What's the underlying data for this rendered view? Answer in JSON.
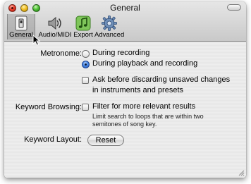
{
  "window": {
    "title": "General"
  },
  "toolbar": {
    "tabs": [
      {
        "label": "General",
        "icon": "general-switch-icon",
        "selected": true
      },
      {
        "label": "Audio/MIDI",
        "icon": "speaker-icon",
        "selected": false
      },
      {
        "label": "Export",
        "icon": "music-note-icon",
        "selected": false
      },
      {
        "label": "Advanced",
        "icon": "gear-icon",
        "selected": false
      }
    ]
  },
  "metronome": {
    "label": "Metronome:",
    "options": [
      {
        "label": "During recording",
        "selected": false
      },
      {
        "label": "During playback and recording",
        "selected": true
      }
    ]
  },
  "discard": {
    "line1": "Ask before discarding unsaved changes",
    "line2": "in instruments and presets",
    "checked": false
  },
  "keyword_browsing": {
    "label": "Keyword Browsing:",
    "option": "Filter for more relevant results",
    "hint_line1": "Limit search to loops that are within two",
    "hint_line2": "semitones of song key.",
    "checked": false
  },
  "keyword_layout": {
    "label": "Keyword Layout:",
    "button": "Reset"
  },
  "colors": {
    "accent": "#4a8ae6",
    "close": "#e8402e",
    "minimize": "#f2c12a",
    "zoom": "#53c43a"
  }
}
